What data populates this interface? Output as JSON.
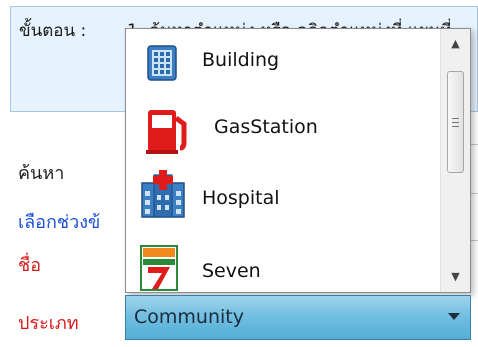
{
  "info": {
    "step_label": "ขั้นตอน :",
    "step_text": "1. ค้นหาตำแหน่ง หรือ คลิกตำแหน่งที่ แผนที่"
  },
  "form": {
    "search_label": "ค้นหา",
    "range_label": "เลือกช่วงข้",
    "name_label": "ชื่อ",
    "type_label": "ประเภท"
  },
  "dropdown": {
    "options": [
      {
        "label": "Building",
        "icon": "building-icon"
      },
      {
        "label": "GasStation",
        "icon": "gas-station-icon"
      },
      {
        "label": "Hospital",
        "icon": "hospital-icon"
      },
      {
        "label": "Seven",
        "icon": "seven-eleven-icon"
      }
    ]
  },
  "combo": {
    "selected": "Community"
  },
  "colors": {
    "info_bg": "#e6f2fd",
    "combo_bg": "#6fbde0",
    "label_red": "#d61a1a",
    "label_blue": "#1a4fd6"
  }
}
